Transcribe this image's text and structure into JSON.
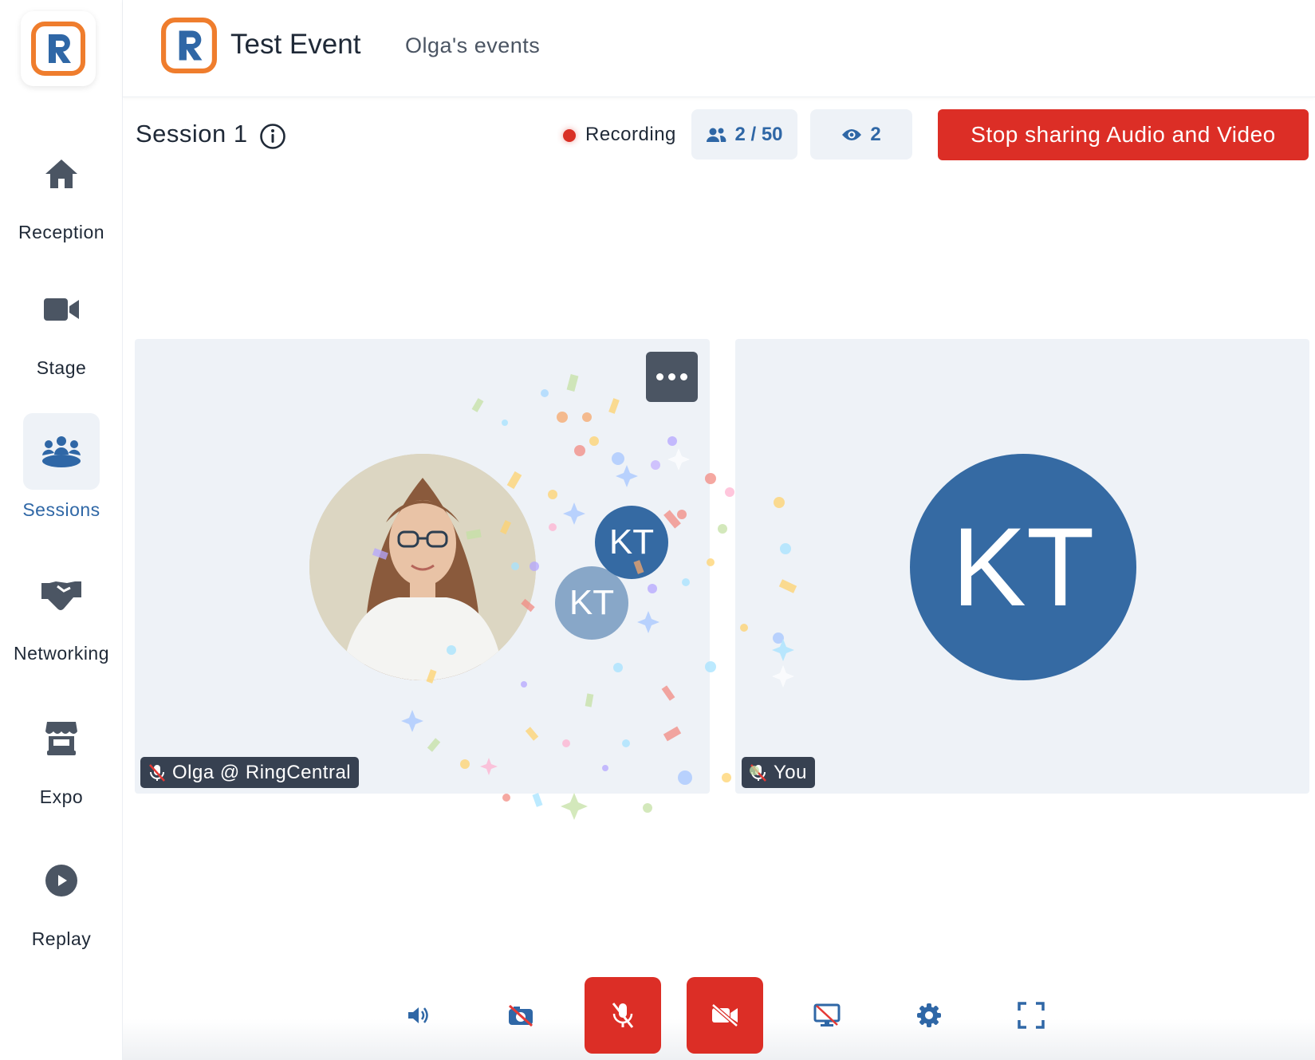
{
  "sidebar": {
    "items": [
      {
        "label": "Reception",
        "icon": "home-icon"
      },
      {
        "label": "Stage",
        "icon": "video-camera-icon"
      },
      {
        "label": "Sessions",
        "icon": "people-group-icon",
        "active": true
      },
      {
        "label": "Networking",
        "icon": "handshake-icon"
      },
      {
        "label": "Expo",
        "icon": "storefront-icon"
      },
      {
        "label": "Replay",
        "icon": "play-circle-icon"
      }
    ]
  },
  "header": {
    "event_title": "Test Event",
    "organizer": "Olga's events"
  },
  "session": {
    "title": "Session 1",
    "recording_label": "Recording",
    "attendees": "2 / 50",
    "viewers": "2",
    "stop_button": "Stop sharing Audio and Video"
  },
  "tiles": [
    {
      "name": "Olga @ RingCentral",
      "muted": true,
      "avatar_initials": [
        "KT",
        "KT"
      ]
    },
    {
      "name": "You",
      "muted": true,
      "avatar_initials": "KT"
    }
  ],
  "toolbar": {
    "buttons": [
      "speaker-icon",
      "camera-off-icon",
      "mic-muted-icon",
      "video-off-icon",
      "screen-share-off-icon",
      "settings-gear-icon",
      "fullscreen-icon"
    ]
  },
  "colors": {
    "accent": "#2f67a6",
    "danger": "#dc2e26",
    "tile_bg": "#eef2f7",
    "avatar_blue": "#356aa3",
    "logo_orange": "#ef7d2d"
  }
}
